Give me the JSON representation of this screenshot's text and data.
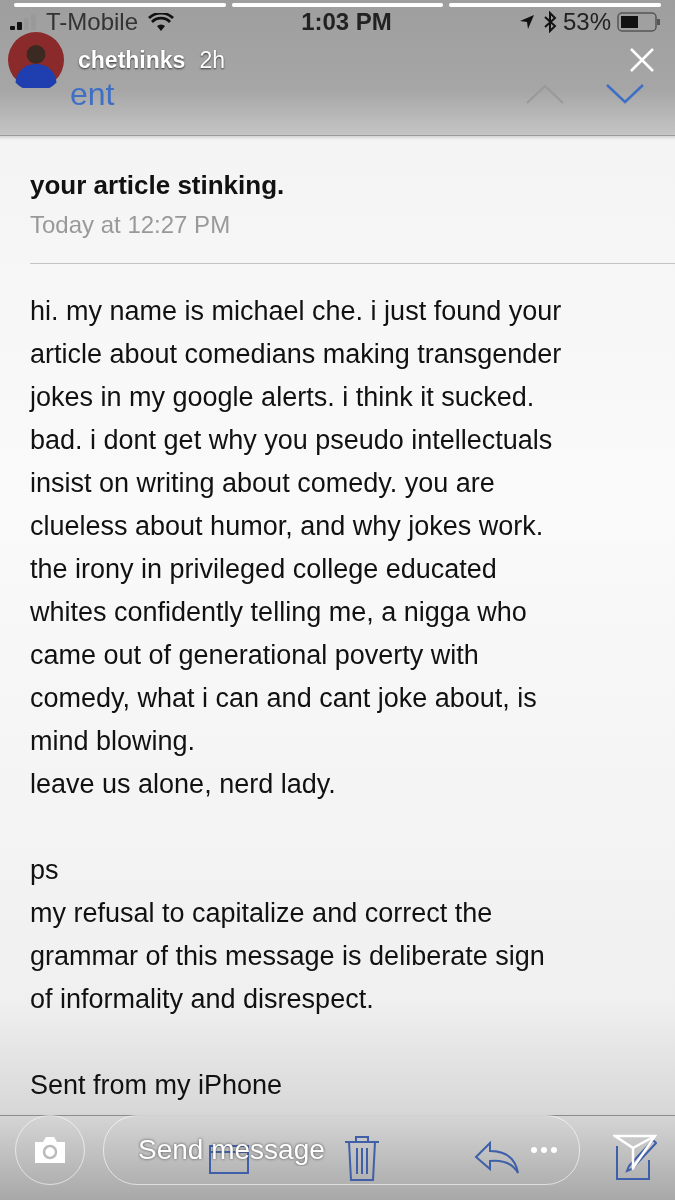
{
  "status_bar": {
    "carrier": "T-Mobile",
    "time": "1:03 PM",
    "battery": "53%"
  },
  "story": {
    "segments": [
      {
        "level": 1
      },
      {
        "level": 1
      },
      {
        "level": 1
      }
    ],
    "username": "chethinks",
    "age": "2h"
  },
  "mail_nav": {
    "back_label": "ent"
  },
  "email": {
    "subject": "your article stinking.",
    "date": "Today at 12:27 PM",
    "paragraphs": [
      "hi. my name is michael che. i just found your\narticle about comedians making transgender\njokes in my google alerts. i think it sucked.\nbad. i dont get why you pseudo intellectuals\ninsist on writing about comedy. you are\nclueless about humor, and why jokes work.\nthe irony in privileged college educated\nwhites confidently telling me, a nigga who\ncame out of generational poverty with\ncomedy, what i can and cant joke about, is\nmind blowing.\nleave us alone, nerd lady.",
      "ps\nmy refusal to capitalize and correct the\ngrammar of this message is deliberate sign\nof informality and disrespect.",
      "Sent from my iPhone"
    ]
  },
  "reply_bar": {
    "placeholder": "Send message"
  }
}
